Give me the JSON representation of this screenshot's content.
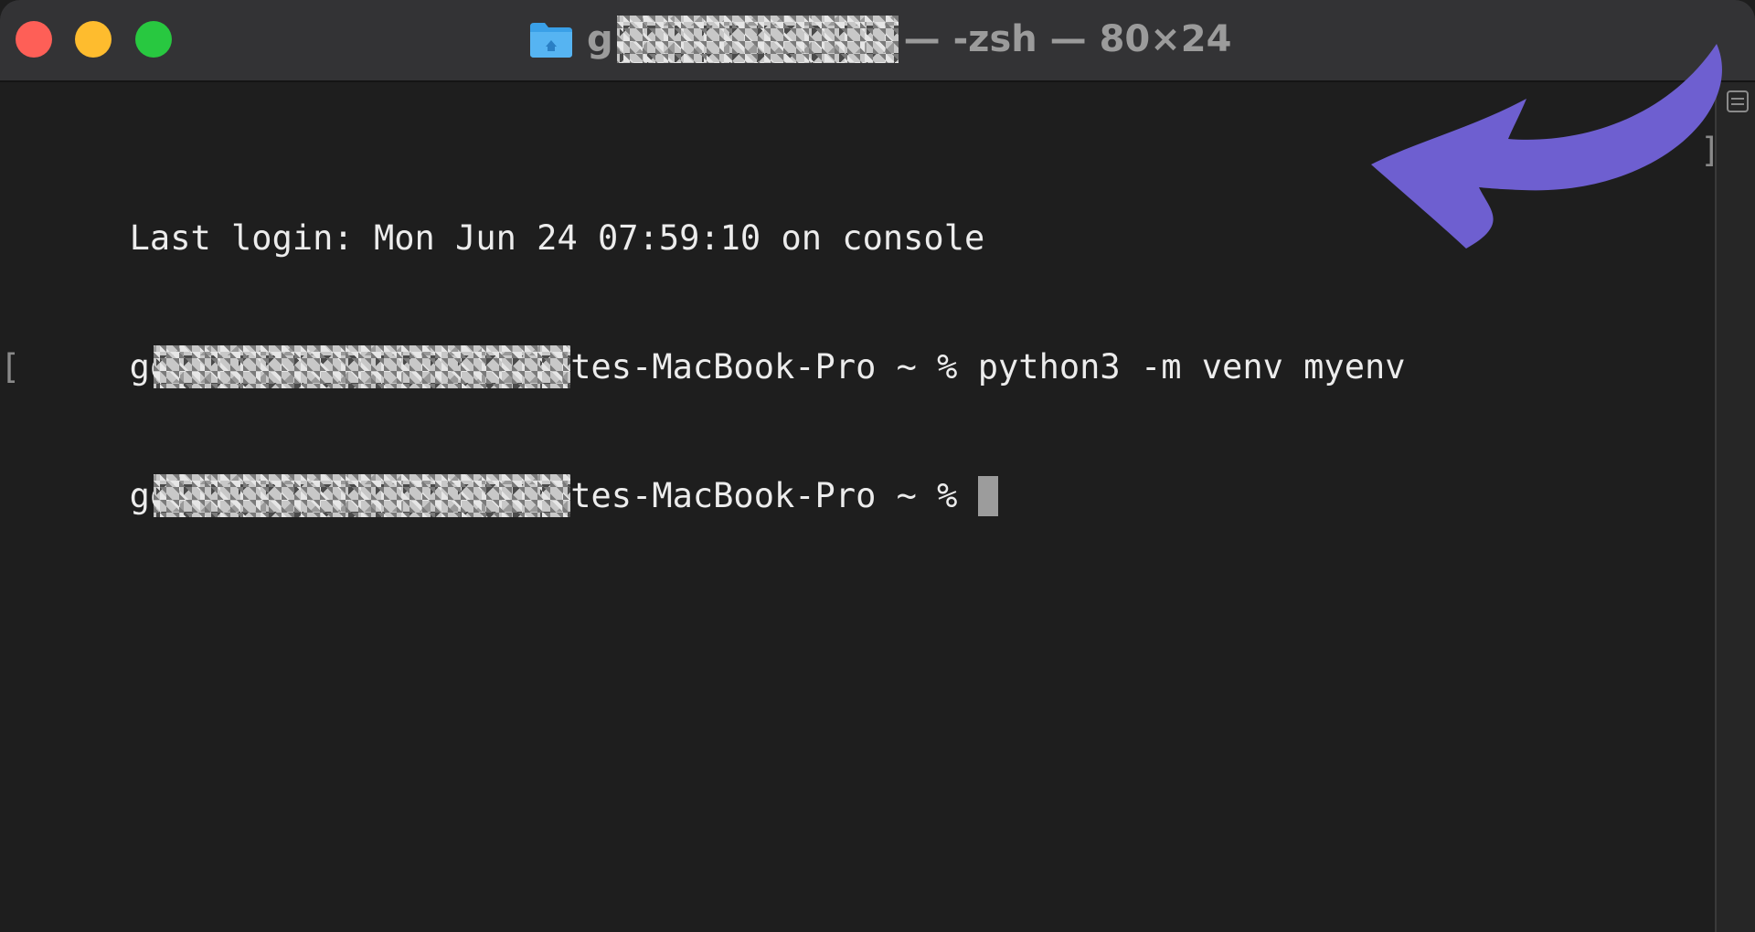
{
  "window": {
    "title": {
      "prefix": "g",
      "suffix": " — -zsh — 80×24"
    }
  },
  "terminal": {
    "lines": [
      {
        "text": "Last login: Mon Jun 24 07:59:10 on console"
      },
      {
        "prefix": "go",
        "host_suffix": "tes-MacBook-Pro ~ % python3 -m venv myenv"
      },
      {
        "prefix": "go",
        "host_suffix": "tes-MacBook-Pro ~ % "
      }
    ]
  },
  "icons": {
    "folder": "folder-icon",
    "split": "split-pane-icon",
    "annotation": "curved-arrow-icon"
  },
  "colors": {
    "close": "#fe5f57",
    "minimize": "#febc2e",
    "maximize": "#28c840",
    "arrow": "#6e5fd0",
    "folder": "#3aa0e8"
  }
}
